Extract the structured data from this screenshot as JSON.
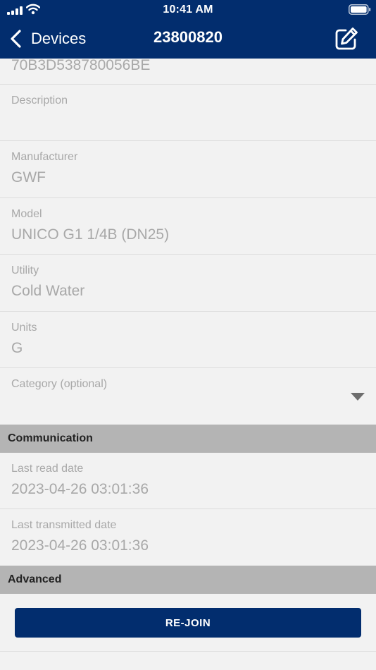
{
  "status_bar": {
    "time": "10:41 AM"
  },
  "nav": {
    "back_label": "Devices",
    "title": "23800820"
  },
  "fields": {
    "top_value": "70B3D538780056BE",
    "description": {
      "label": "Description",
      "value": ""
    },
    "manufacturer": {
      "label": "Manufacturer",
      "value": "GWF"
    },
    "model": {
      "label": "Model",
      "value": "UNICO G1 1/4B (DN25)"
    },
    "utility": {
      "label": "Utility",
      "value": "Cold Water"
    },
    "units": {
      "label": "Units",
      "value": "G"
    },
    "category": {
      "label": "Category (optional)",
      "value": ""
    }
  },
  "communication": {
    "title": "Communication",
    "last_read": {
      "label": "Last read date",
      "value": "2023-04-26 03:01:36"
    },
    "last_transmitted": {
      "label": "Last transmitted date",
      "value": "2023-04-26 03:01:36"
    }
  },
  "advanced": {
    "title": "Advanced",
    "rejoin_label": "RE-JOIN"
  },
  "colors": {
    "brand": "#022d6e",
    "section_bg": "#b4b4b4",
    "field_text": "#a8a8a8"
  }
}
